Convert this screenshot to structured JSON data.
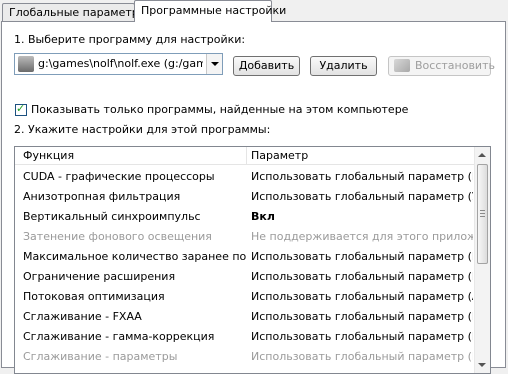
{
  "tabs": [
    {
      "label": "Глобальные параметры"
    },
    {
      "label": "Программные настройки"
    }
  ],
  "step1": {
    "label": "1. Выберите программу для настройки:",
    "program_value": "g:\\games\\nolf\\nolf.exe (g:/games, "
  },
  "buttons": {
    "add": "Добавить",
    "remove": "Удалить",
    "restore": "Восстановить"
  },
  "checkbox": {
    "label": "Показывать только программы, найденные на этом компьютере",
    "checked": true
  },
  "step2": {
    "label": "2. Укажите настройки для этой программы:"
  },
  "table": {
    "columns": [
      "Функция",
      "Параметр"
    ],
    "rows": [
      {
        "feature": "CUDA - графические процессоры",
        "param": "Использовать глобальный параметр (Все)",
        "disabled": false
      },
      {
        "feature": "Анизотропная фильтрация",
        "param": "Использовать глобальный параметр (У...",
        "disabled": false
      },
      {
        "feature": "Вертикальный синхроимпульс",
        "param": "Вкл",
        "disabled": false
      },
      {
        "feature": "Затенение фонового освещения",
        "param": "Не поддерживается для этого приложе...",
        "disabled": true
      },
      {
        "feature": "Максимальное количество заранее под...",
        "param": "Использовать глобальный параметр (И...",
        "disabled": false
      },
      {
        "feature": "Ограничение расширения",
        "param": "Использовать глобальный параметр (В...",
        "disabled": false
      },
      {
        "feature": "Потоковая оптимизация",
        "param": "Использовать глобальный параметр (А...",
        "disabled": false
      },
      {
        "feature": "Сглаживание - FXAA",
        "param": "Использовать глобальный параметр (В...",
        "disabled": false
      },
      {
        "feature": "Сглаживание - гамма-коррекция",
        "param": "Использовать глобальный параметр (Вкл)",
        "disabled": false
      },
      {
        "feature": "Сглаживание - параметры",
        "param": "Использовать глобальный параметр (Н...",
        "disabled": true
      }
    ]
  },
  "icons": {
    "program": "program-avatar-icon",
    "restore": "nvidia-logo-icon",
    "dropdown": "chevron-down-icon",
    "scroll_up": "arrow-up-icon",
    "scroll_down": "arrow-down-icon"
  }
}
